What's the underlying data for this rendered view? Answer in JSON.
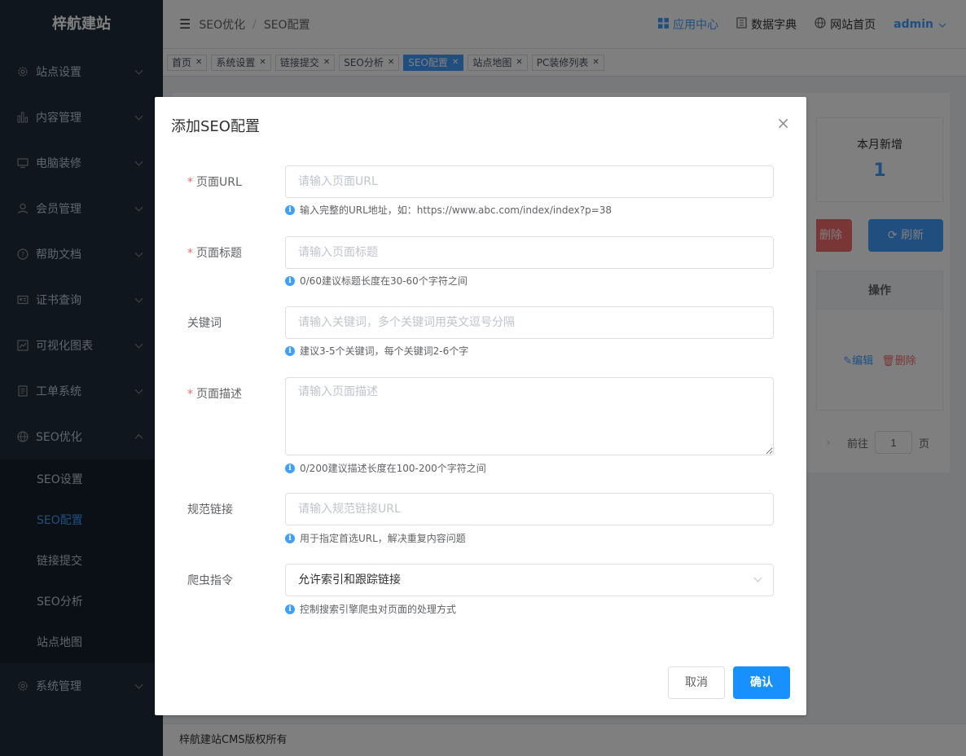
{
  "sidebar": {
    "logo": "梓航建站",
    "items": [
      {
        "label": "站点设置"
      },
      {
        "label": "内容管理"
      },
      {
        "label": "电脑装修"
      },
      {
        "label": "会员管理"
      },
      {
        "label": "帮助文档"
      },
      {
        "label": "证书查询"
      },
      {
        "label": "可视化图表"
      },
      {
        "label": "工单系统"
      },
      {
        "label": "SEO优化"
      },
      {
        "label": "系统管理"
      }
    ],
    "seo_submenu": [
      {
        "label": "SEO设置"
      },
      {
        "label": "SEO配置"
      },
      {
        "label": "链接提交"
      },
      {
        "label": "SEO分析"
      },
      {
        "label": "站点地图"
      }
    ]
  },
  "header": {
    "breadcrumb": [
      "SEO优化",
      "SEO配置"
    ],
    "app_center": "应用中心",
    "data_dict": "数据字典",
    "site_home": "网站首页",
    "user": "admin"
  },
  "tags": [
    {
      "label": "首页"
    },
    {
      "label": "系统设置"
    },
    {
      "label": "链接提交"
    },
    {
      "label": "SEO分析"
    },
    {
      "label": "SEO配置"
    },
    {
      "label": "站点地图"
    },
    {
      "label": "PC装修列表"
    }
  ],
  "background": {
    "stat_label": "本月新增",
    "stat_value": "1",
    "delete_partial": "删除",
    "refresh": "刷新",
    "col_ops": "操作",
    "edit": "编辑",
    "delete": "删除",
    "goto": "前往",
    "page": "1",
    "page_unit": "页"
  },
  "footer": "梓航建站CMS版权所有",
  "dialog": {
    "title": "添加SEO配置",
    "fields": {
      "url": {
        "label": "页面URL",
        "placeholder": "请输入页面URL",
        "hint": "输入完整的URL地址，如：https://www.abc.com/index/index?p=38"
      },
      "title": {
        "label": "页面标题",
        "placeholder": "请输入页面标题",
        "hint": "0/60建议标题长度在30-60个字符之间"
      },
      "keywords": {
        "label": "关键词",
        "placeholder": "请输入关键词，多个关键词用英文逗号分隔",
        "hint": "建议3-5个关键词，每个关键词2-6个字"
      },
      "description": {
        "label": "页面描述",
        "placeholder": "请输入页面描述",
        "hint": "0/200建议描述长度在100-200个字符之间"
      },
      "canonical": {
        "label": "规范链接",
        "placeholder": "请输入规范链接URL",
        "hint": "用于指定首选URL，解决重复内容问题"
      },
      "robots": {
        "label": "爬虫指令",
        "value": "允许索引和跟踪链接",
        "hint": "控制搜索引擎爬虫对页面的处理方式"
      }
    },
    "cancel": "取消",
    "confirm": "确认"
  },
  "colors": {
    "primary": "#409eff",
    "sidebar_bg": "#1f2d3d",
    "danger": "#f56c6c",
    "confirm": "#1890ff"
  }
}
